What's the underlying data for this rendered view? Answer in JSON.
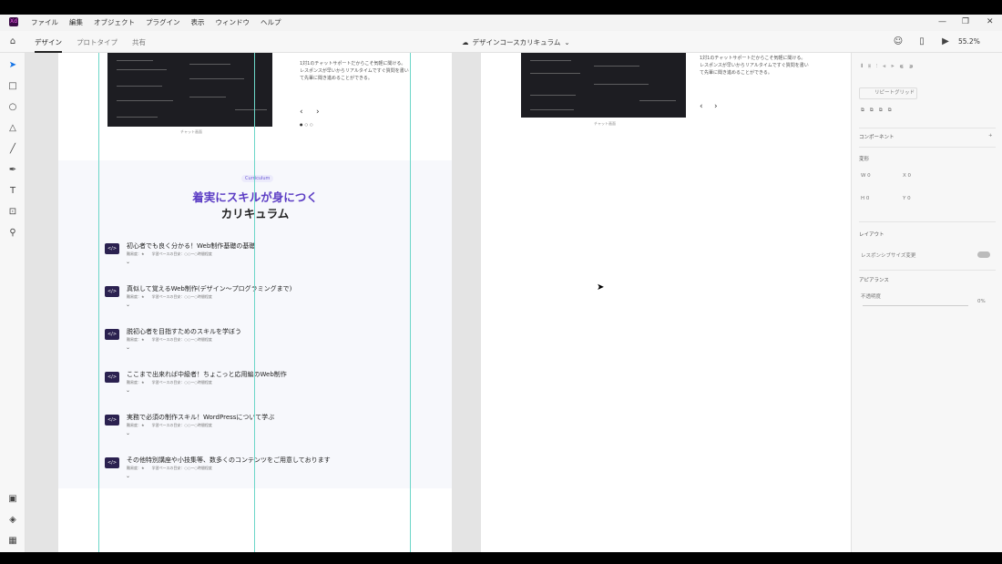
{
  "menu": [
    "ファイル",
    "編集",
    "オブジェクト",
    "プラグイン",
    "表示",
    "ウィンドウ",
    "ヘルプ"
  ],
  "tabs": [
    "デザイン",
    "プロトタイプ",
    "共有"
  ],
  "doc_name": "デザインコースカリキュラム",
  "zoom": "55.2%",
  "chat_caption": "チャット画面",
  "chat_desc": "1対1のチャットサポートだからこそ気軽に聞ける。レスポンスが早いからリアルタイムですぐ質問を書いて先輩に聞き進めることができる。",
  "badge": "Curriculum",
  "heading_line1_purple": "着実にスキルが身につく",
  "heading_line2": "カリキュラム",
  "curriculum": [
    {
      "title": "初心者でも良く分かる！Web制作基礎の基礎",
      "meta": "難易度：★　　学習ペースの目安：○○〜○時間程度"
    },
    {
      "title": "真似して覚えるWeb制作(デザイン〜プログラミングまで)",
      "meta": "難易度：★　　学習ペースの目安：○○〜○時間程度"
    },
    {
      "title": "脱初心者を目指すためのスキルを学ぼう",
      "meta": "難易度：★　　学習ペースの目安：○○〜○時間程度"
    },
    {
      "title": "ここまで出来れば中級者！ちょこっと応用編のWeb制作",
      "meta": "難易度：★　　学習ペースの目安：○○〜○時間程度"
    },
    {
      "title": "実務で必須の制作スキル！WordPressについて学ぶ",
      "meta": "難易度：★　　学習ペースの目安：○○〜○時間程度"
    },
    {
      "title": "その他特別講座や小技集等、数多くのコンテンツをご用意しております",
      "meta": "難易度：★　　学習ペースの目安：○○〜○時間程度"
    }
  ],
  "right_panel": {
    "repeat_grid": "リピートグリッド",
    "component": "コンポーネント",
    "transform": "変形",
    "w": "W 0",
    "x": "X 0",
    "h": "H 0",
    "y": "Y 0",
    "layout": "レイアウト",
    "responsive": "レスポンシブサイズ変更",
    "appearance": "アピアランス",
    "opacity_label": "不透明度",
    "opacity_value": "0%"
  }
}
